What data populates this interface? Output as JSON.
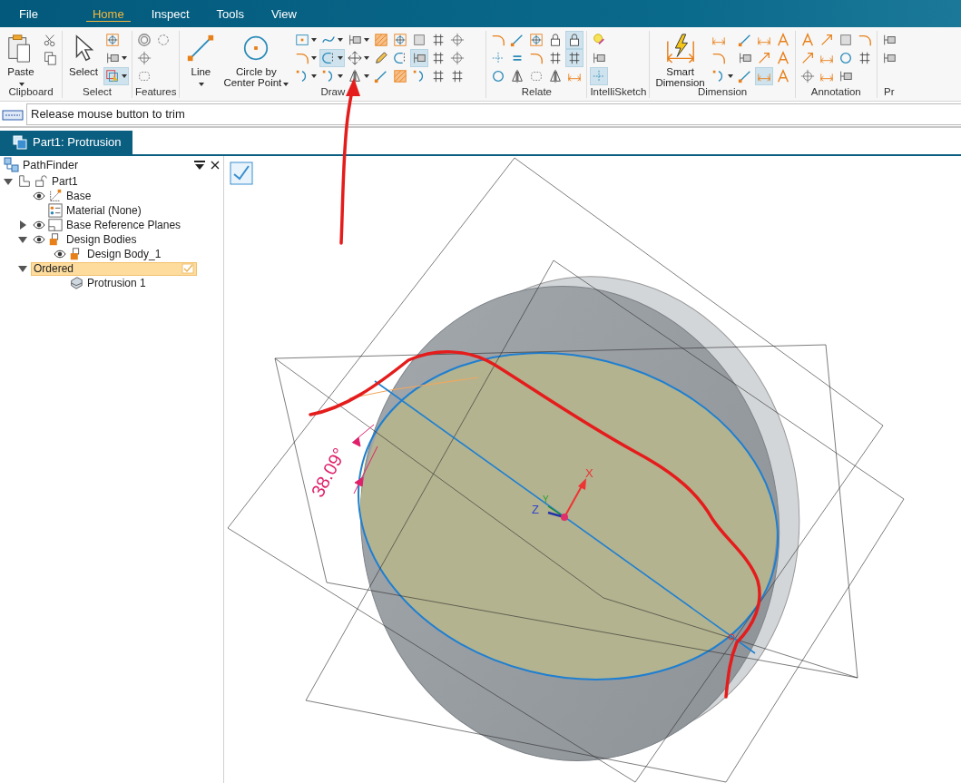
{
  "menu_tabs": [
    {
      "label": "File",
      "selected": false
    },
    {
      "label": "Home",
      "selected": true
    },
    {
      "label": "Inspect",
      "selected": false
    },
    {
      "label": "Tools",
      "selected": false
    },
    {
      "label": "View",
      "selected": false
    }
  ],
  "ribbon_groups": [
    {
      "label": "Clipboard",
      "large_buttons": [
        {
          "label": "Paste",
          "dropdown": true
        }
      ],
      "tools": [
        {
          "selected": false,
          "dropdown": false
        },
        {
          "selected": false,
          "dropdown": false
        }
      ]
    },
    {
      "label": "Select",
      "large_buttons": [
        {
          "label": "Select",
          "dropdown": false
        }
      ],
      "tools": [
        {
          "selected": false,
          "dropdown": false
        },
        {
          "selected": false,
          "dropdown": true
        },
        {
          "selected": true,
          "dropdown": true
        }
      ]
    },
    {
      "label": "Features",
      "tools": [
        {
          "selected": false,
          "dropdown": false
        },
        {
          "selected": false,
          "dropdown": false
        },
        {
          "selected": false,
          "dropdown": false
        },
        {
          "selected": false,
          "dropdown": false
        }
      ]
    },
    {
      "label": "Draw",
      "large_buttons": [
        {
          "label": "Line",
          "dropdown": true
        },
        {
          "label": "Circle by Center Point",
          "dropdown": true
        }
      ],
      "tools": [
        {
          "selected": false,
          "dropdown": true
        },
        {
          "selected": false,
          "dropdown": true
        },
        {
          "selected": false,
          "dropdown": true
        },
        {
          "selected": false,
          "dropdown": true
        },
        {
          "selected": true,
          "dropdown": true
        },
        {
          "selected": false,
          "dropdown": true
        },
        {
          "selected": false,
          "dropdown": true
        },
        {
          "selected": false,
          "dropdown": true
        },
        {
          "selected": false,
          "dropdown": true
        },
        {
          "selected": false,
          "dropdown": false
        },
        {
          "selected": false,
          "dropdown": false
        },
        {
          "selected": false,
          "dropdown": false
        },
        {
          "selected": false,
          "dropdown": false
        },
        {
          "selected": false,
          "dropdown": false
        },
        {
          "selected": false,
          "dropdown": false
        },
        {
          "selected": false,
          "dropdown": false
        },
        {
          "selected": true,
          "dropdown": false
        },
        {
          "selected": false,
          "dropdown": false
        },
        {
          "selected": false,
          "dropdown": false
        },
        {
          "selected": false,
          "dropdown": false
        },
        {
          "selected": false,
          "dropdown": false
        },
        {
          "selected": false,
          "dropdown": false
        },
        {
          "selected": false,
          "dropdown": false
        },
        {
          "selected": false,
          "dropdown": false
        }
      ]
    },
    {
      "label": "Relate",
      "tools": [
        {
          "selected": false,
          "dropdown": false
        },
        {
          "selected": false,
          "dropdown": false
        },
        {
          "selected": false,
          "dropdown": false
        },
        {
          "selected": false,
          "dropdown": false
        },
        {
          "selected": false,
          "dropdown": false
        },
        {
          "selected": false,
          "dropdown": false
        },
        {
          "selected": false,
          "dropdown": false
        },
        {
          "selected": false,
          "dropdown": false
        },
        {
          "selected": false,
          "dropdown": false
        },
        {
          "selected": false,
          "dropdown": false
        },
        {
          "selected": false,
          "dropdown": false
        },
        {
          "selected": false,
          "dropdown": false
        },
        {
          "selected": true,
          "dropdown": false
        },
        {
          "selected": true,
          "dropdown": false
        },
        {
          "selected": false,
          "dropdown": false
        }
      ]
    },
    {
      "label": "IntelliSketch",
      "tools": [
        {
          "selected": false,
          "dropdown": false
        },
        {
          "selected": false,
          "dropdown": false
        },
        {
          "selected": true,
          "dropdown": false
        }
      ]
    },
    {
      "label": "Dimension",
      "large_buttons": [
        {
          "label": "Smart Dimension",
          "dropdown": false
        }
      ],
      "tools": [
        {
          "selected": false,
          "dropdown": false
        },
        {
          "selected": false,
          "dropdown": false
        },
        {
          "selected": false,
          "dropdown": true
        },
        {
          "selected": false,
          "dropdown": false
        },
        {
          "selected": false,
          "dropdown": false
        },
        {
          "selected": false,
          "dropdown": false
        },
        {
          "selected": false,
          "dropdown": false
        },
        {
          "selected": false,
          "dropdown": false
        },
        {
          "selected": true,
          "dropdown": false
        },
        {
          "selected": false,
          "dropdown": false
        },
        {
          "selected": false,
          "dropdown": false
        },
        {
          "selected": false,
          "dropdown": false
        }
      ]
    },
    {
      "label": "Annotation",
      "tools": [
        {
          "selected": false,
          "dropdown": false
        },
        {
          "selected": false,
          "dropdown": false
        },
        {
          "selected": false,
          "dropdown": false
        },
        {
          "selected": false,
          "dropdown": false
        },
        {
          "selected": false,
          "dropdown": false
        },
        {
          "selected": false,
          "dropdown": false
        },
        {
          "selected": false,
          "dropdown": false
        },
        {
          "selected": false,
          "dropdown": false
        },
        {
          "selected": false,
          "dropdown": false
        },
        {
          "selected": false,
          "dropdown": false
        },
        {
          "selected": false,
          "dropdown": false
        }
      ]
    },
    {
      "label": "Pr",
      "tools": [
        {
          "selected": false,
          "dropdown": false
        },
        {
          "selected": false,
          "dropdown": false
        }
      ]
    }
  ],
  "prompt": {
    "text": "Release mouse button to trim"
  },
  "document_tab": {
    "label": "Part1: Protrusion"
  },
  "pathfinder": {
    "title": "PathFinder",
    "tree": [
      {
        "label": "Part1",
        "expanded": true,
        "selected": false,
        "children": [
          {
            "label": "Base",
            "visible": true,
            "selected": false
          },
          {
            "label": "Material (None)",
            "selected": false
          },
          {
            "label": "Base Reference Planes",
            "visible": true,
            "expanded": false,
            "selected": false
          },
          {
            "label": "Design Bodies",
            "visible": true,
            "expanded": true,
            "selected": false,
            "children": [
              {
                "label": "Design Body_1",
                "visible": true,
                "selected": false
              }
            ]
          },
          {
            "label": "Ordered",
            "expanded": true,
            "selected": true,
            "children": [
              {
                "label": "Protrusion 1",
                "selected": false
              }
            ]
          }
        ]
      }
    ]
  },
  "viewport": {
    "dimension": "38.09°",
    "axis_labels": [
      "X",
      "Y",
      "Z"
    ]
  }
}
